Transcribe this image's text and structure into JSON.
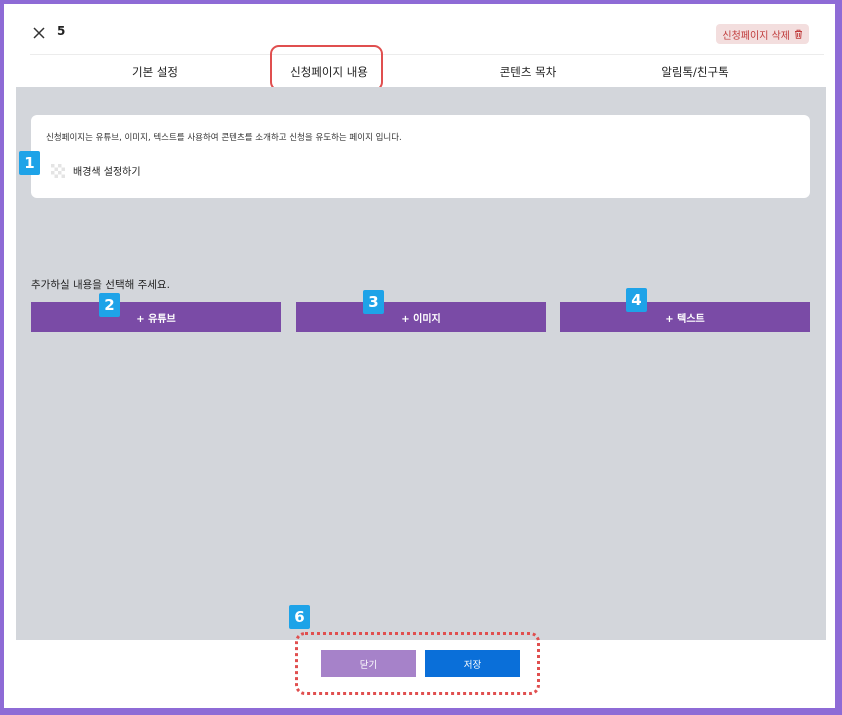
{
  "header": {
    "count": "5",
    "delete_label": "신청페이지 삭제"
  },
  "tabs": [
    {
      "label": "기본 설정"
    },
    {
      "label": "신청페이지 내용"
    },
    {
      "label": "콘텐츠 목차"
    },
    {
      "label": "알림톡/친구톡"
    }
  ],
  "info": {
    "description": "신청페이지는 유튜브, 이미지, 텍스트를 사용하여 콘텐츠를 소개하고 신청을 유도하는 페이지 입니다.",
    "background_label": "배경색 설정하기"
  },
  "add_section": {
    "prompt": "추가하실 내용을 선택해 주세요.",
    "buttons": [
      {
        "label": "+ 유튜브"
      },
      {
        "label": "+ 이미지"
      },
      {
        "label": "+ 텍스트"
      }
    ]
  },
  "footer": {
    "close_label": "닫기",
    "save_label": "저장"
  },
  "markers": [
    "1",
    "2",
    "3",
    "4",
    "6"
  ],
  "colors": {
    "accent_purple": "#7a4ba6",
    "save_blue": "#0a6fd9",
    "highlight_red": "#e04f4f",
    "marker_blue": "#1ea3e8"
  }
}
